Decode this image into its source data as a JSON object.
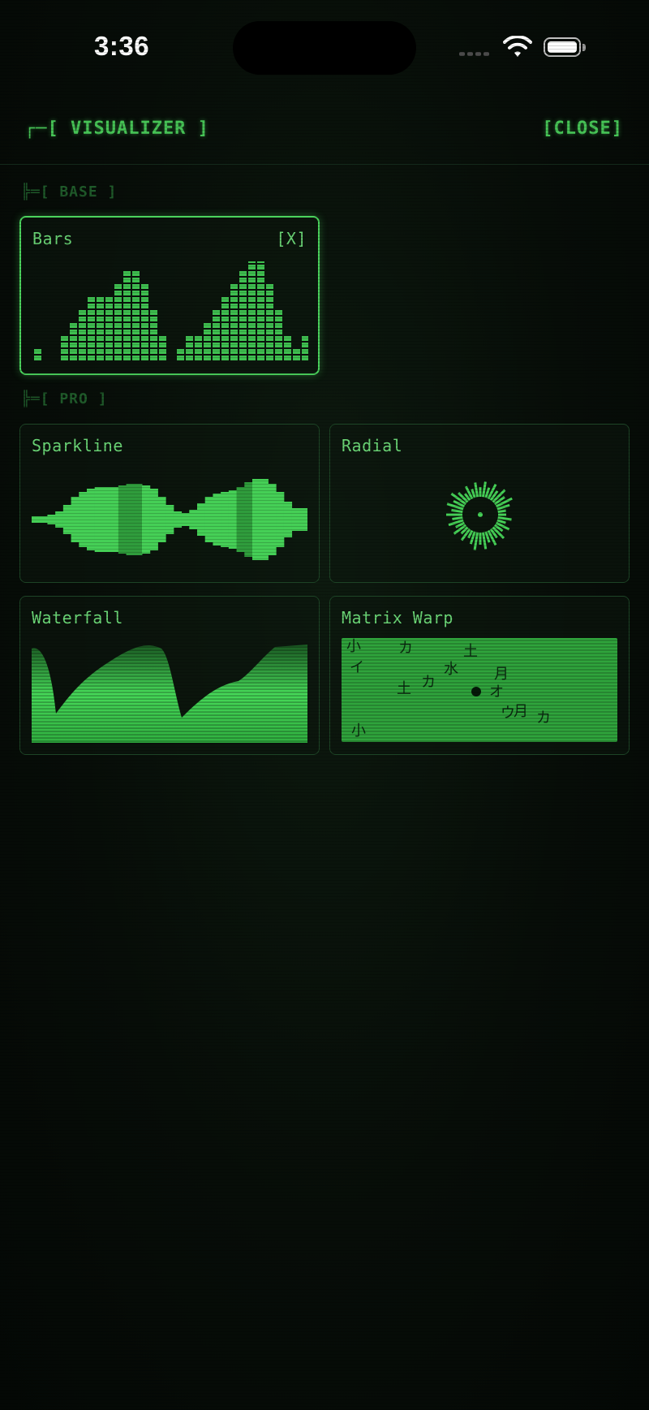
{
  "status_bar": {
    "time": "3:36",
    "icons": [
      "signal-icon",
      "wifi-icon",
      "battery-icon"
    ]
  },
  "header": {
    "title": "┌─[ VISUALIZER ]",
    "close_label": "[CLOSE]"
  },
  "sections": {
    "base": "╠═[ BASE ]",
    "pro": "╠═[ PRO ]"
  },
  "cards": {
    "bars": {
      "label": "Bars",
      "close": "[X]",
      "active": true
    },
    "sparkline": {
      "label": "Sparkline"
    },
    "radial": {
      "label": "Radial"
    },
    "waterfall": {
      "label": "Waterfall"
    },
    "matrix_warp": {
      "label": "Matrix Warp",
      "glyphs": [
        "小",
        "カ",
        "イ",
        "土",
        "水",
        "月",
        "カ",
        "小",
        "土",
        "オ",
        "ウ",
        "月",
        "カ"
      ]
    }
  },
  "colors": {
    "accent": "#4bd35d",
    "dim": "#1f5a2a",
    "background": "#070d08"
  }
}
